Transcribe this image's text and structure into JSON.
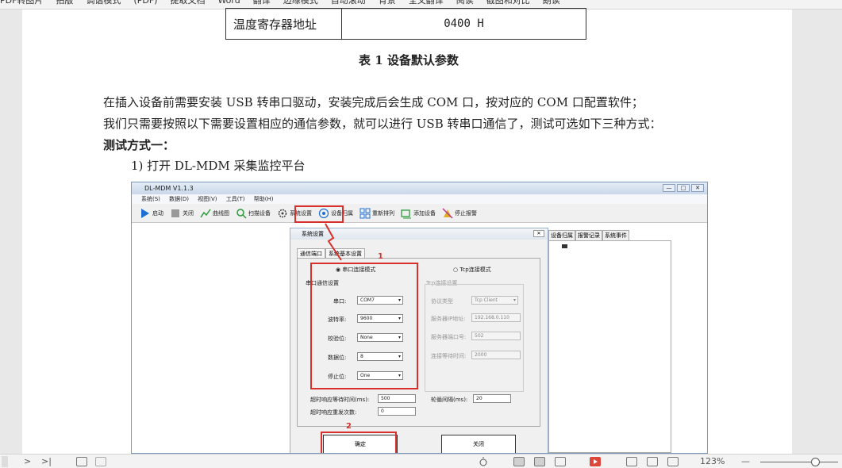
{
  "topbar": {
    "items": [
      "PDF转图片",
      "拍版",
      "调谐模式",
      "(PDF)",
      "提取文档",
      "Word",
      "翻译",
      "边缘模式",
      "自动滚动",
      "背景",
      "全文翻译",
      "阅读",
      "截图和对比",
      "朗读"
    ]
  },
  "doc": {
    "table_label": "温度寄存器地址",
    "table_value": "0400 H",
    "caption": "表 1 设备默认参数",
    "para1": "在插入设备前需要安装 USB 转串口驱动，安装完成后会生成 COM 口，按对应的 COM 口配置软件；",
    "para2": "我们只需要按照以下需要设置相应的通信参数，就可以进行 USB 转串口通信了，测试可选如下三种方式：",
    "heading": "测试方式一：",
    "step1": "1)   打开 DL-MDM 采集监控平台"
  },
  "shot": {
    "title": "DL-MDM V1.1.3",
    "menu": [
      "系统(S)",
      "数据(D)",
      "视图(V)",
      "工具(T)",
      "帮助(H)"
    ],
    "toolbar": [
      "启动",
      "关闭",
      "曲线图",
      "扫描设备",
      "系统设置",
      "设备归属",
      "重新排列",
      "添加设备",
      "停止报警"
    ],
    "right_tabs": [
      "设备归属",
      "报警记录",
      "系统事件"
    ],
    "win_buttons": [
      "—",
      "□",
      "✕"
    ]
  },
  "dialog": {
    "title": "系统设置",
    "close": "✕",
    "tabs": [
      "通信端口",
      "系统基本设置"
    ],
    "serial_mode": "串口连接模式",
    "tcp_mode": "Tcp连接模式",
    "serial_group": "串口通信设置",
    "tcp_group": "Tcp连接设置",
    "fields": [
      {
        "label": "串口:",
        "value": "COM7"
      },
      {
        "label": "波特率:",
        "value": "9600"
      },
      {
        "label": "校验位:",
        "value": "None"
      },
      {
        "label": "数据位:",
        "value": "8"
      },
      {
        "label": "停止位:",
        "value": "One"
      }
    ],
    "tcp_fields": [
      {
        "label": "协议类型",
        "value": "Tcp Client"
      },
      {
        "label": "服务器IP地址:",
        "value": "192.168.0.110"
      },
      {
        "label": "服务器端口号:",
        "value": "502"
      },
      {
        "label": "连接等待时间:",
        "value": "2000"
      }
    ],
    "timeout_label": "超时响应等待时间(ms):",
    "timeout_value": "500",
    "poll_label": "轮循间隔(ms):",
    "poll_value": "20",
    "retry_label": "超时响应重发次数:",
    "retry_value": "0",
    "ok": "确定",
    "cancel": "关闭",
    "marker1": "1",
    "marker2": "2"
  },
  "statusbar": {
    "nav_next": ">",
    "nav_last": ">|",
    "zoom": "123%",
    "zoom_minus": "—"
  }
}
